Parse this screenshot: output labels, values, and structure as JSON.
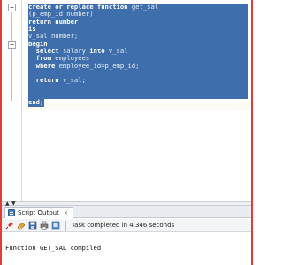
{
  "editor": {
    "lines": [
      {
        "kw": "create or replace function ",
        "tx": "get_sal"
      },
      {
        "kw": "",
        "tx": "(p_emp_id number)"
      },
      {
        "kw": "return number",
        "tx": ""
      },
      {
        "kw": "is",
        "tx": ""
      },
      {
        "kw": "",
        "tx": "v_sal number;"
      },
      {
        "kw": "begin",
        "tx": ""
      },
      {
        "kw": "  select ",
        "tx": "salary ",
        "kw2": "into ",
        "tx2": "v_sal"
      },
      {
        "kw": "  from ",
        "tx": "employees"
      },
      {
        "kw": "  where ",
        "tx": "employee_id=p_emp_id;"
      },
      {
        "kw": "",
        "tx": ""
      },
      {
        "kw": "  return ",
        "tx": "v_sal;"
      },
      {
        "kw": "",
        "tx": ""
      },
      {
        "kw": "",
        "tx": ""
      },
      {
        "kw": "end;",
        "tx": ""
      }
    ]
  },
  "output_panel": {
    "tab_label": "Script Output",
    "tab_close": "×",
    "status": "Task completed in 4.346 seconds",
    "output_text": "Function GET_SAL compiled"
  },
  "colors": {
    "frame_border": "#e53b36",
    "selection": "#3e6eab"
  },
  "icons": [
    "pin-icon",
    "eraser-icon",
    "save-icon",
    "print-icon",
    "open-icon"
  ]
}
